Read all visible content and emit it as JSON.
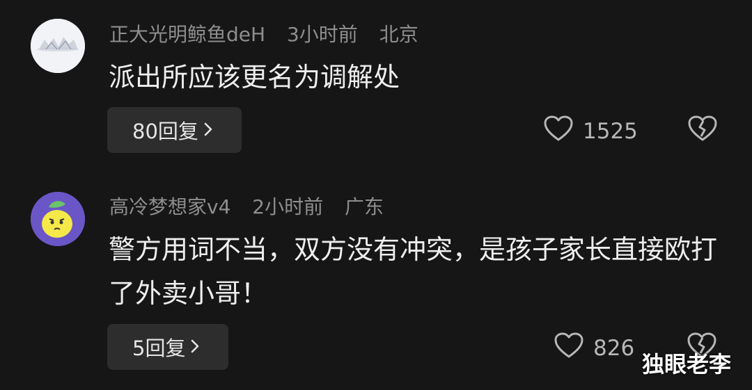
{
  "comments": [
    {
      "username": "正大光明鲸鱼deH",
      "time": "3小时前",
      "location": "北京",
      "text": "派出所应该更名为调解处",
      "reply_label": "80回复",
      "likes": "1525",
      "avatar_icon": "snowy-tree-landscape",
      "accent": "#f1f2f5"
    },
    {
      "username": "高冷梦想家v4",
      "time": "2小时前",
      "location": "广东",
      "text": "警方用词不当，双方没有冲突，是孩子家长直接欧打了外卖小哥！",
      "reply_label": "5回复",
      "likes": "826",
      "avatar_icon": "lemon-character",
      "accent": "#6b56c7"
    }
  ],
  "icons": {
    "like": "heart-outline-icon",
    "dislike": "broken-heart-icon",
    "reply_chevron": "chevron-right-icon"
  },
  "colors": {
    "background": "#161616",
    "button": "#2d2d2d",
    "meta_text": "#8e8e8e",
    "body_text": "#eeeeee"
  },
  "watermark": "独眼老李"
}
